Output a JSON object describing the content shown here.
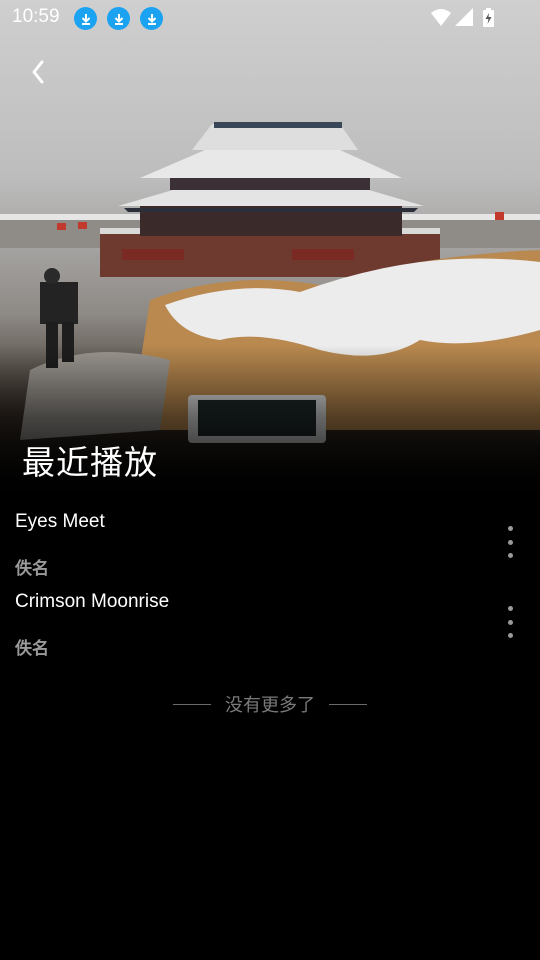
{
  "status_bar": {
    "time": "10:59",
    "notification_icons": [
      "download-icon",
      "download-icon",
      "download-icon"
    ],
    "system_icons": [
      "wifi-icon",
      "cell-signal-icon",
      "battery-charging-icon"
    ],
    "accent_color": "#1ba3f2"
  },
  "header": {
    "back_icon": "back-arrow-icon",
    "title": "最近播放"
  },
  "tracks": [
    {
      "title": "Eyes Meet",
      "artist": "佚名",
      "menu_icon": "more-vertical-icon"
    },
    {
      "title": "Crimson Moonrise",
      "artist": "佚名",
      "menu_icon": "more-vertical-icon"
    }
  ],
  "footer": {
    "end_text": "没有更多了"
  }
}
